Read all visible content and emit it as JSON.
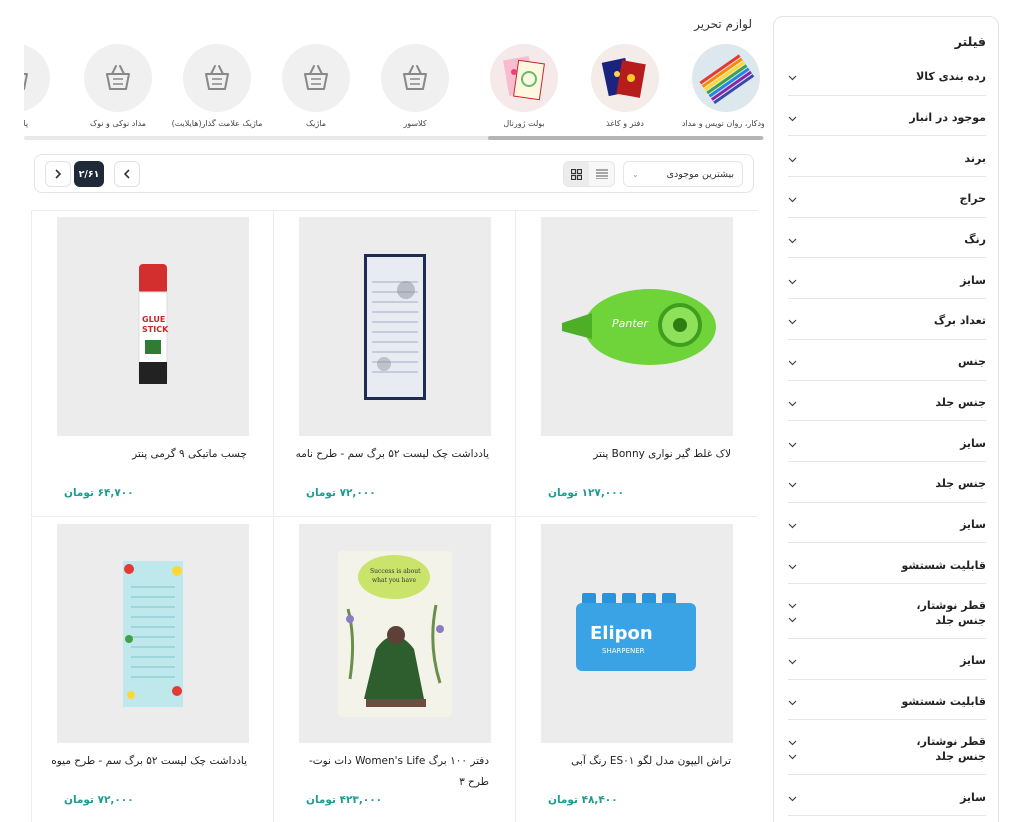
{
  "sidebar": {
    "title": "فیلتر",
    "filters": [
      {
        "label": "رده بندی کالا"
      },
      {
        "label": "موجود در انبار"
      },
      {
        "label": "برند"
      },
      {
        "label": "حراج"
      },
      {
        "label": "رنگ"
      },
      {
        "label": "سایز"
      },
      {
        "label": "تعداد برگ"
      },
      {
        "label": "جنس"
      },
      {
        "label": "جنس جلد"
      },
      {
        "label": "سایز"
      },
      {
        "label": "جنس جلد"
      },
      {
        "label": "سایز"
      },
      {
        "label": "قابلیت شستشو"
      },
      {
        "label": "قطر نوشتار،",
        "label2": "جنس جلد"
      },
      {
        "label": "سایز"
      },
      {
        "label": "قابلیت شستشو"
      },
      {
        "label": "قطر نوشتار،",
        "label2": "جنس جلد"
      },
      {
        "label": "سایز"
      }
    ]
  },
  "categories": {
    "title": "لوازم تحریر",
    "items": [
      {
        "label": "خودکار، روان نویس و مداد",
        "icon": "pens-image"
      },
      {
        "label": "دفتر و کاغذ",
        "icon": "notebooks-image"
      },
      {
        "label": "بولت ژورنال",
        "icon": "journal-image"
      },
      {
        "label": "کلاسور",
        "icon": "basket-icon"
      },
      {
        "label": "ماژیک",
        "icon": "basket-icon"
      },
      {
        "label": "ماژیک علامت گذار(هایلایت)",
        "icon": "basket-icon"
      },
      {
        "label": "مداد نوکی و نوک",
        "icon": "basket-icon"
      },
      {
        "label": "پاک کن",
        "icon": "basket-icon"
      }
    ]
  },
  "toolbar": {
    "sort_selected": "بیشترین موجودی",
    "page_indicator": "۲/۶۱"
  },
  "products": [
    {
      "title": "لاک غلط گیر نواری Bonny پنتر",
      "price": "۱۲۷,۰۰۰ تومان"
    },
    {
      "title": "یادداشت چک لیست ۵۲ برگ سم - طرح نامه",
      "price": "۷۲,۰۰۰ تومان"
    },
    {
      "title": "چسب ماتیکی ۹ گرمی پنتر",
      "price": "۶۴,۷۰۰ تومان"
    },
    {
      "title": "تراش الیپون مدل لگو ES۰۱ رنگ آبی",
      "price": "۴۸,۴۰۰ تومان"
    },
    {
      "title": "دفتر ۱۰۰ برگ Women's Life دات نوت- طرح ۳",
      "price": "۴۲۳,۰۰۰ تومان"
    },
    {
      "title": "یادداشت چک لیست ۵۲ برگ سم - طرح میوه",
      "price": "۷۲,۰۰۰ تومان"
    }
  ],
  "colors": {
    "price": "#1a9c8e",
    "pager_active": "#1f2937"
  }
}
